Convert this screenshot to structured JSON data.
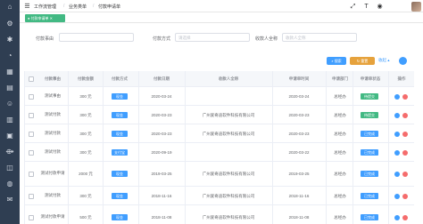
{
  "breadcrumb": [
    "工作流管理",
    "业务类单",
    "付款申请单"
  ],
  "tab": {
    "label": "付款申请单"
  },
  "filters": [
    {
      "label": "付款事由",
      "placeholder": ""
    },
    {
      "label": "付款方式",
      "placeholder": "请选择"
    },
    {
      "label": "收款人全称",
      "placeholder": "收款人全称"
    }
  ],
  "toolbar": {
    "search_label": "搜索",
    "reset_label": "重置",
    "collapse_label": "收起"
  },
  "table": {
    "headers": [
      "付款事由",
      "付款金额",
      "付款方式",
      "付款日期",
      "收款人全称",
      "申请单时间",
      "申请部门",
      "申请单状态",
      "操作"
    ],
    "rows": [
      {
        "reason": "测试事由",
        "amount": "300 元",
        "method": "现金",
        "date": "2020-03-24",
        "payee": "",
        "apply_date": "2020-03-24",
        "dept": "总经办",
        "status": "待提交",
        "status_color": "#42b983",
        "method_color": "#409eff"
      },
      {
        "reason": "测试付款",
        "amount": "300 元",
        "method": "现金",
        "date": "2020-03-23",
        "payee": "广州爱奇迪软件科技有限公司",
        "apply_date": "2020-03-23",
        "dept": "总经办",
        "status": "待提交",
        "status_color": "#42b983",
        "method_color": "#409eff"
      },
      {
        "reason": "测试付款",
        "amount": "300 元",
        "method": "现金",
        "date": "2020-03-23",
        "payee": "广州爱奇迪软件科技有限公司",
        "apply_date": "2020-03-23",
        "dept": "总经办",
        "status": "已完成",
        "status_color": "#409eff",
        "method_color": "#409eff"
      },
      {
        "reason": "测试付款",
        "amount": "300 元",
        "method": "支付宝",
        "date": "2020-09-19",
        "payee": "",
        "apply_date": "2020-03-22",
        "dept": "总经办",
        "status": "已完成",
        "status_color": "#409eff",
        "method_color": "#409eff"
      },
      {
        "reason": "测试付款申请",
        "amount": "2000 元",
        "method": "现金",
        "date": "2019-03-25",
        "payee": "广州爱奇迪软件科技有限公司",
        "apply_date": "2019-03-25",
        "dept": "总经办",
        "status": "已完成",
        "status_color": "#409eff",
        "method_color": "#409eff"
      },
      {
        "reason": "测试付款",
        "amount": "300 元",
        "method": "现金",
        "date": "2018-11-16",
        "payee": "广州爱奇迪软件科技有限公司",
        "apply_date": "2018-11-16",
        "dept": "总经办",
        "status": "已完成",
        "status_color": "#409eff",
        "method_color": "#409eff"
      },
      {
        "reason": "测试付款申请",
        "amount": "500 元",
        "method": "现金",
        "date": "2018-11-08",
        "payee": "广州爱奇迪软件科技有限公司",
        "apply_date": "2018-11-08",
        "dept": "总经办",
        "status": "已完成",
        "status_color": "#409eff",
        "method_color": "#409eff"
      }
    ]
  },
  "colors": {
    "sidebar": "#2f3e52",
    "primary": "#409eff",
    "success": "#42b983",
    "warning": "#e6a23c",
    "danger": "#f56c6c"
  },
  "icons": {
    "sidebar": [
      "home-icon",
      "gear-icon",
      "settings-icon",
      "pie-chart-icon",
      "calendar-icon",
      "document-icon",
      "users-icon",
      "chart-icon",
      "grid-icon",
      "workflow-icon",
      "book-icon",
      "globe-icon",
      "message-icon"
    ],
    "topbar": [
      "menu-fold-icon",
      "fullscreen-icon",
      "text-size-icon",
      "github-icon"
    ]
  }
}
